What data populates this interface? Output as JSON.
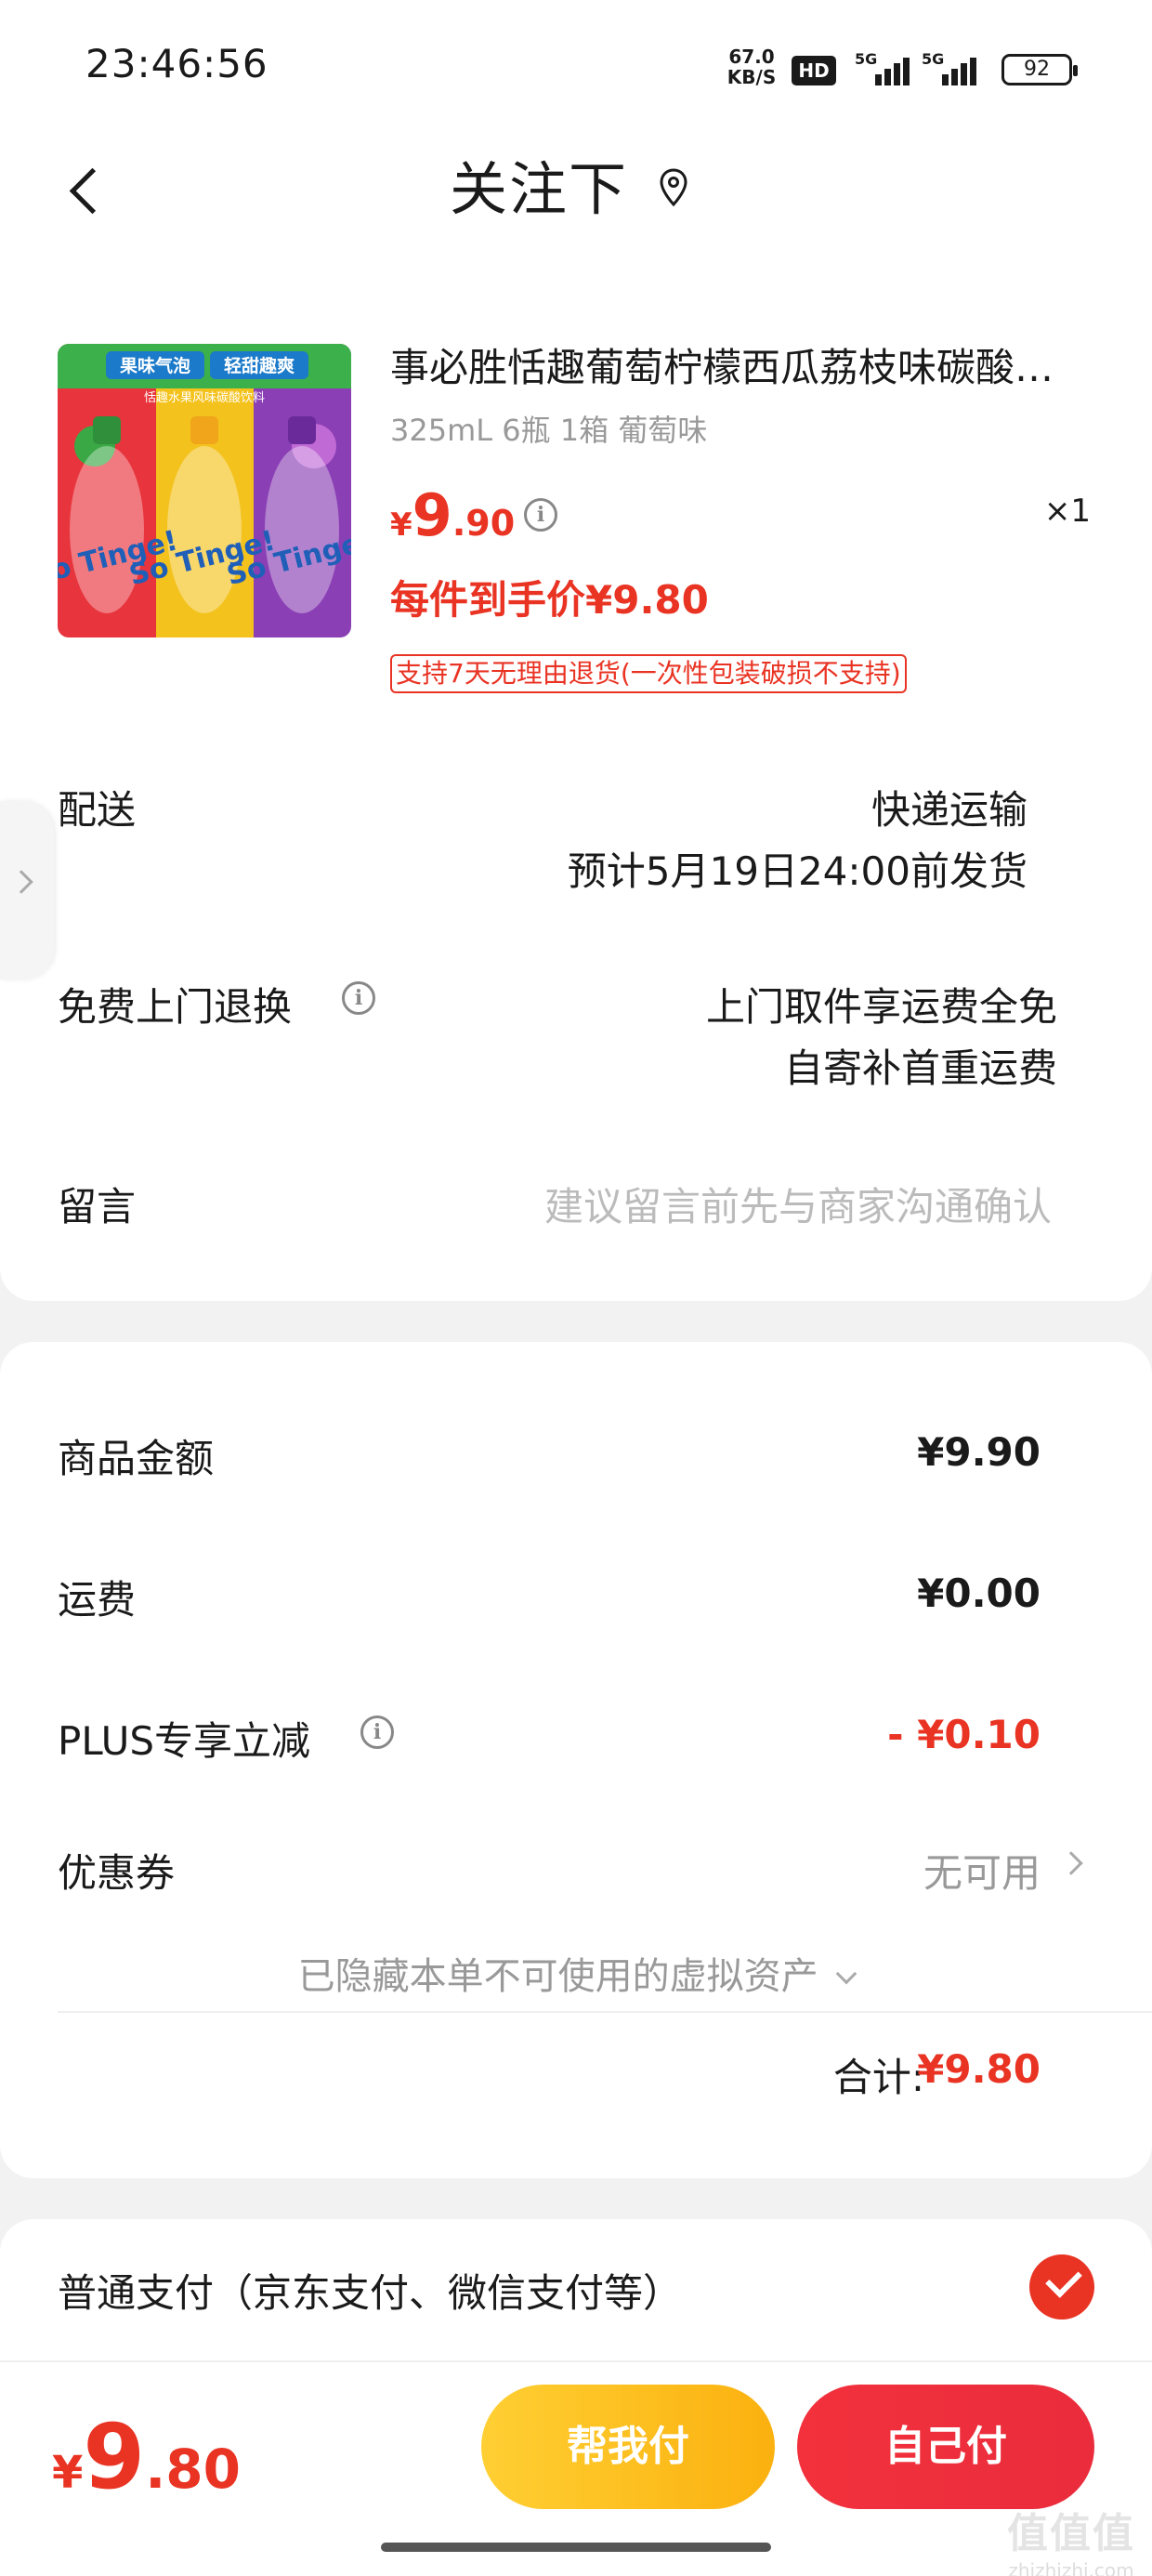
{
  "status_bar": {
    "time": "23:46:56",
    "net_speed_value": "67.0",
    "net_speed_unit": "KB/S",
    "hd_label": "HD",
    "signal_1": "5G",
    "signal_2": "5G",
    "battery": "92"
  },
  "header": {
    "title": "关注下"
  },
  "product": {
    "name": "事必胜恬趣葡萄柠檬西瓜荔枝味碳酸饮料",
    "spec": "325mL 6瓶 1箱 葡萄味",
    "price_currency": "¥",
    "price_int": "9",
    "price_dec": ".90",
    "quantity": "×1",
    "final_price": "每件到手价¥9.80",
    "return_policy": "支持7天无理由退货(一次性包装破损不支持)",
    "image_banner_1": "果味气泡",
    "image_banner_2": "轻甜趣爽",
    "image_subtitle": "恬趣水果风味碳酸饮料",
    "image_brand": "So Tinge!"
  },
  "delivery": {
    "label": "配送",
    "method": "快递运输",
    "estimate": "预计5月19日24:00前发货"
  },
  "return_service": {
    "label": "免费上门退换",
    "line1": "上门取件享运费全免",
    "line2": "自寄补首重运费"
  },
  "message": {
    "label": "留言",
    "placeholder": "建议留言前先与商家沟通确认"
  },
  "costs": {
    "goods_label": "商品金额",
    "goods_value": "¥9.90",
    "shipping_label": "运费",
    "shipping_value": "¥0.00",
    "plus_label": "PLUS专享立减",
    "plus_value": "- ¥0.10",
    "coupon_label": "优惠券",
    "coupon_value": "无可用",
    "hidden_assets": "已隐藏本单不可使用的虚拟资产",
    "total_label": "合计:",
    "total_value": "¥9.80"
  },
  "payment": {
    "label": "普通支付（京东支付、微信支付等）"
  },
  "bottom": {
    "price_currency": "¥",
    "price_int": "9",
    "price_dec": ".80",
    "help_pay": "帮我付",
    "self_pay": "自己付"
  },
  "watermark": {
    "big": "值值值",
    "small": "zhizhizhi.com"
  },
  "colors": {
    "accent_red": "#e93323",
    "help_button_yellow": "#fbb10f",
    "self_button_red": "#ea2c3c"
  }
}
